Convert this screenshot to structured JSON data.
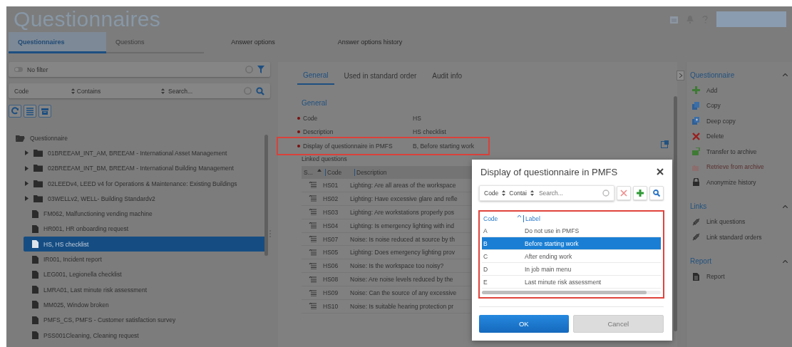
{
  "app": {
    "title": "Questionnaires"
  },
  "tabs": [
    {
      "label": "Questionnaires",
      "selected": true
    },
    {
      "label": "Questions",
      "selected": false
    },
    {
      "label": "Answer options",
      "selected": false
    },
    {
      "label": "Answer options history",
      "selected": false
    }
  ],
  "filter": {
    "label": "No filter"
  },
  "search": {
    "field": "Code",
    "operator": "Contains",
    "placeholder": "Search..."
  },
  "tree": {
    "label": "Questionnaire",
    "expanded": true,
    "children": [
      {
        "label": "01BREEAM_INT_AM, BREEAM - International Asset Management",
        "kind": "folder",
        "selected": false
      },
      {
        "label": "02BREEAM_INT_BM, BREEAM - International Building Management",
        "kind": "folder",
        "selected": false
      },
      {
        "label": "02LEEDv4, LEED v4 for Operations & Maintenance: Existing Buildings",
        "kind": "folder",
        "selected": false
      },
      {
        "label": "03WELLv2, WELL- Building Standardv2",
        "kind": "folder",
        "selected": false
      },
      {
        "label": "FM062, Malfunctioning vending machine",
        "kind": "file",
        "selected": false
      },
      {
        "label": "HR001, HR onboarding request",
        "kind": "file",
        "selected": false
      },
      {
        "label": "HS, HS checklist",
        "kind": "file",
        "selected": true
      },
      {
        "label": "IR001, Incident report",
        "kind": "file",
        "selected": false
      },
      {
        "label": "LEG001, Legionella checklist",
        "kind": "file",
        "selected": false
      },
      {
        "label": "LMRA01, Last minute risk assessment",
        "kind": "file",
        "selected": false
      },
      {
        "label": "MM025, Window broken",
        "kind": "file",
        "selected": false
      },
      {
        "label": "PMFS_CS, PMFS - Customer satisfaction survey",
        "kind": "file",
        "selected": false
      },
      {
        "label": "PSS001Cleaning, Cleaning request",
        "kind": "file",
        "selected": false
      }
    ]
  },
  "detail": {
    "tabs": [
      {
        "label": "General",
        "selected": true
      },
      {
        "label": "Used in standard order",
        "selected": false
      },
      {
        "label": "Audit info",
        "selected": false
      }
    ],
    "section": "General",
    "fields": [
      {
        "label": "Code",
        "value": "HS",
        "required": true,
        "highlighted": false
      },
      {
        "label": "Description",
        "value": "HS checklist",
        "required": true,
        "highlighted": false
      },
      {
        "label": "Display of questionnaire in PMFS",
        "value": "B, Before starting work",
        "required": true,
        "highlighted": true
      }
    ],
    "linked": {
      "title": "Linked questions",
      "columns": [
        "S...",
        "Code",
        "Description"
      ],
      "rows": [
        {
          "code": "HS01",
          "description": "Lighting: Are all areas of the workspace"
        },
        {
          "code": "HS02",
          "description": "Lighting: Have excessive glare and refle"
        },
        {
          "code": "HS03",
          "description": "Lighting: Are workstations properly pos"
        },
        {
          "code": "HS04",
          "description": "Lighting: Is emergency lighting with ind"
        },
        {
          "code": "HS07",
          "description": "Noise: Is noise reduced at source by th"
        },
        {
          "code": "HS05",
          "description": "Lighting: Does emergency lighting prov"
        },
        {
          "code": "HS06",
          "description": "Noise: Is the workspace too noisy?"
        },
        {
          "code": "HS08",
          "description": "Noise: Are noise levels reduced by the"
        },
        {
          "code": "HS09",
          "description": "Noise: Can the source of any excessive"
        },
        {
          "code": "HS10",
          "description": "Noise: Is suitable hearing protection pr"
        }
      ]
    }
  },
  "sidebar": {
    "sections": [
      {
        "title": "Questionnaire",
        "expanded": true,
        "items": [
          {
            "label": "Add",
            "disabled": false
          },
          {
            "label": "Copy",
            "disabled": false
          },
          {
            "label": "Deep copy",
            "disabled": false
          },
          {
            "label": "Delete",
            "disabled": false
          },
          {
            "label": "Transfer to archive",
            "disabled": false
          },
          {
            "label": "Retrieve from archive",
            "disabled": true
          },
          {
            "label": "Anonymize history",
            "disabled": false
          }
        ]
      },
      {
        "title": "Links",
        "expanded": true,
        "items": [
          {
            "label": "Link questions",
            "disabled": false
          },
          {
            "label": "Link standard orders",
            "disabled": false
          }
        ]
      },
      {
        "title": "Report",
        "expanded": true,
        "items": [
          {
            "label": "Report",
            "disabled": false
          }
        ]
      }
    ]
  },
  "dialog": {
    "title": "Display of questionnaire in PMFS",
    "search": {
      "field": "Code",
      "operator": "Contai",
      "placeholder": "Search..."
    },
    "highlighted": true,
    "columns": [
      "Code",
      "Label"
    ],
    "rows": [
      {
        "code": "A",
        "label": "Do not use in PMFS",
        "selected": false
      },
      {
        "code": "B",
        "label": "Before starting work",
        "selected": true
      },
      {
        "code": "C",
        "label": "After ending work",
        "selected": false
      },
      {
        "code": "D",
        "label": "In job main menu",
        "selected": false
      },
      {
        "code": "E",
        "label": "Last minute risk assessment",
        "selected": false
      }
    ],
    "buttons": [
      {
        "label": "OK",
        "kind": "primary"
      },
      {
        "label": "Cancel",
        "kind": "secondary"
      }
    ]
  }
}
